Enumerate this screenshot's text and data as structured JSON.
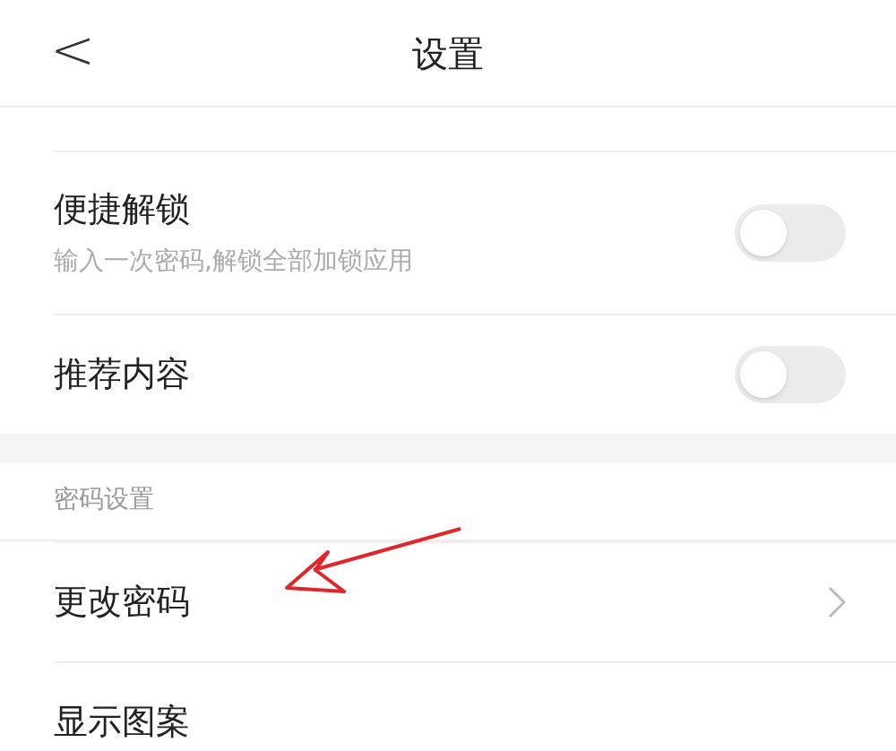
{
  "header": {
    "back": "<",
    "title": "设置"
  },
  "groups": [
    {
      "items": [
        {
          "kind": "toggle",
          "title": "便捷解锁",
          "subtitle": "输入一次密码,解锁全部加锁应用",
          "on": false
        },
        {
          "kind": "toggle",
          "title": "推荐内容",
          "on": false
        }
      ]
    },
    {
      "section": "密码设置",
      "items": [
        {
          "kind": "link",
          "title": "更改密码"
        },
        {
          "kind": "plain",
          "title": "显示图案"
        }
      ]
    }
  ]
}
